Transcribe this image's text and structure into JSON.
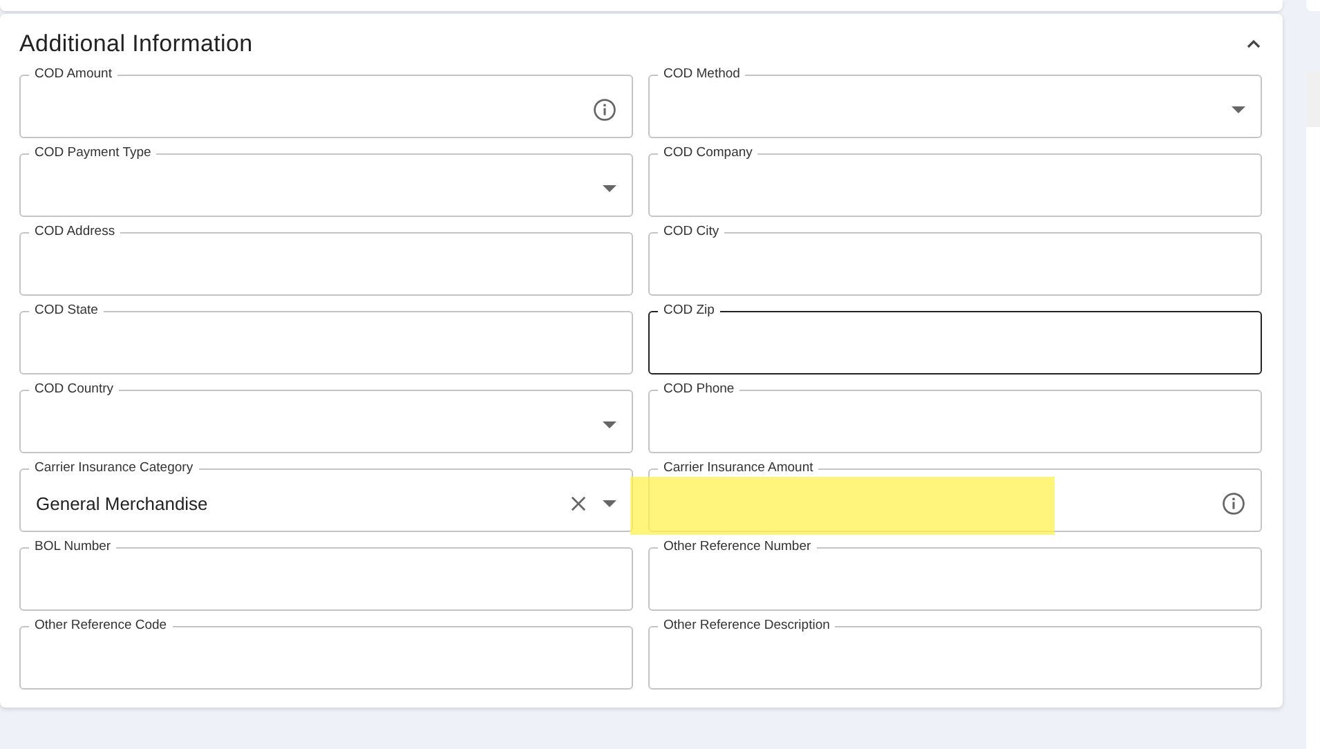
{
  "section": {
    "title": "Additional Information",
    "expanded": true,
    "fields": [
      {
        "label": "COD Amount",
        "kind": "info",
        "focused": false
      },
      {
        "label": "COD Method",
        "kind": "select",
        "focused": false
      },
      {
        "label": "COD Payment Type",
        "kind": "select",
        "focused": false
      },
      {
        "label": "COD Company",
        "kind": "text",
        "focused": false
      },
      {
        "label": "COD Address",
        "kind": "text",
        "focused": false
      },
      {
        "label": "COD City",
        "kind": "text",
        "focused": false
      },
      {
        "label": "COD State",
        "kind": "text",
        "focused": false
      },
      {
        "label": "COD Zip",
        "kind": "text",
        "focused": true
      },
      {
        "label": "COD Country",
        "kind": "select",
        "focused": false
      },
      {
        "label": "COD Phone",
        "kind": "text",
        "focused": false
      },
      {
        "label": "Carrier Insurance Category",
        "kind": "clearable",
        "focused": false,
        "value": "General Merchandise"
      },
      {
        "label": "Carrier Insurance Amount",
        "kind": "info",
        "focused": false,
        "highlighted": true
      },
      {
        "label": "BOL Number",
        "kind": "text",
        "focused": false
      },
      {
        "label": "Other Reference Number",
        "kind": "text",
        "focused": false
      },
      {
        "label": "Other Reference Code",
        "kind": "text",
        "focused": false
      },
      {
        "label": "Other Reference Description",
        "kind": "text",
        "focused": false
      }
    ]
  }
}
